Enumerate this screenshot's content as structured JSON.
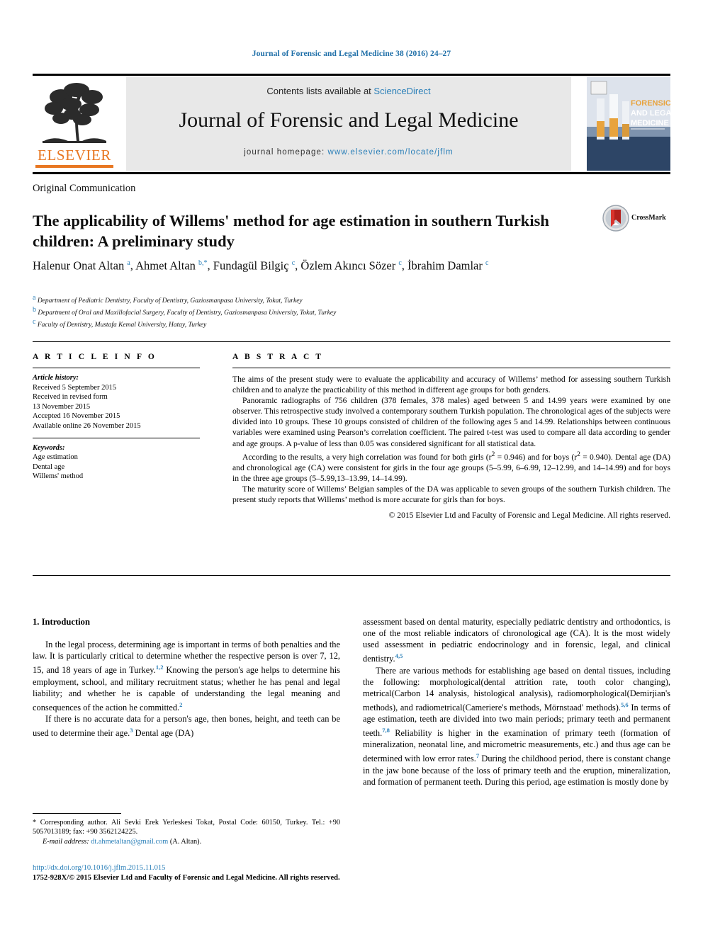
{
  "running_head": "Journal of Forensic and Legal Medicine 38 (2016) 24–27",
  "masthead": {
    "contents_prefix": "Contents lists available at ",
    "contents_link": "ScienceDirect",
    "journal_name": "Journal of Forensic and Legal Medicine",
    "homepage_prefix": "journal homepage: ",
    "homepage_url": "www.elsevier.com/locate/jflm",
    "publisher": "ELSEVIER",
    "cover_title_line1": "FORENSIC",
    "cover_title_line2": "AND LEGAL",
    "cover_title_line3": "MEDICINE",
    "link_color": "#2a7fb8",
    "brand_orange": "#E87722"
  },
  "article": {
    "kicker": "Original Communication",
    "title": "The applicability of Willems' method for age estimation in southern Turkish children: A preliminary study",
    "crossmark_label": "CrossMark",
    "authors_html": "Halenur Onat Altan <sup>a</sup>, Ahmet Altan <sup>b,&#42;</sup>, Fundagül Bilgiç <sup>c</sup>, Özlem Akıncı Sözer <sup>c</sup>, İbrahim Damlar <sup>c</sup>",
    "affiliations": [
      {
        "marker": "a",
        "text": "Department of Pediatric Dentistry, Faculty of Dentistry, Gaziosmanpasa University, Tokat, Turkey"
      },
      {
        "marker": "b",
        "text": "Department of Oral and Maxillofacial Surgery, Faculty of Dentistry, Gaziosmanpasa University, Tokat, Turkey"
      },
      {
        "marker": "c",
        "text": "Faculty of Dentistry, Mustafa Kemal University, Hatay, Turkey"
      }
    ]
  },
  "article_info": {
    "heading": "A R T I C L E  I N F O",
    "history_label": "Article history:",
    "history_lines": [
      "Received 5 September 2015",
      "Received in revised form",
      "13 November 2015",
      "Accepted 16 November 2015",
      "Available online 26 November 2015"
    ],
    "keywords_label": "Keywords:",
    "keywords": [
      "Age estimation",
      "Dental age",
      "Willems' method"
    ]
  },
  "abstract": {
    "heading": "A B S T R A C T",
    "paragraphs": [
      "The aims of the present study were to evaluate the applicability and accuracy of Willems’ method for assessing southern Turkish children and to analyze the practicability of this method in different age groups for both genders.",
      "Panoramic radiographs of 756 children (378 females, 378 males) aged between 5 and 14.99 years were examined by one observer. This retrospective study involved a contemporary southern Turkish population. The chronological ages of the subjects were divided into 10 groups. These 10 groups consisted of children of the following ages 5 and 14.99. Relationships between continuous variables were examined using Pearson’s correlation coefficient. The paired t-test was used to compare all data according to gender and age groups. A p-value of less than 0.05 was considered significant for all statistical data.",
      "According to the results, a very high correlation was found for both girls (r<sup>2</sup> = 0.946) and for boys (r<sup>2</sup> = 0.940). Dental age (DA) and chronological age (CA) were consistent for girls in the four age groups (5–5.99, 6–6.99, 12–12.99, and 14–14.99) and for boys in the three age groups (5–5.99,13–13.99, 14–14.99).",
      "The maturity score of Willems’ Belgian samples of the DA was applicable to seven groups of the southern Turkish children. The present study reports that Willems’ method is more accurate for girls than for boys."
    ],
    "copyright": "© 2015 Elsevier Ltd and Faculty of Forensic and Legal Medicine. All rights reserved."
  },
  "body": {
    "section_number_title": "1. Introduction",
    "left_paragraphs": [
      "In the legal process, determining age is important in terms of both penalties and the law. It is particularly critical to determine whether the respective person is over 7, 12, 15, and 18 years of age in Turkey.<sup class=\"ref\">1,2</sup> Knowing the person's age helps to determine his employment, school, and military recruitment status; whether he has penal and legal liability; and whether he is capable of understanding the legal meaning and consequences of the action he committed.<sup class=\"ref\">2</sup>",
      "If there is no accurate data for a person's age, then bones, height, and teeth can be used to determine their age.<sup class=\"ref\">3</sup> Dental age (DA)"
    ],
    "right_paragraphs": [
      "assessment based on dental maturity, especially pediatric dentistry and orthodontics, is one of the most reliable indicators of chronological age (CA). It is the most widely used assessment in pediatric endocrinology and in forensic, legal, and clinical dentistry.<sup class=\"ref\">4,5</sup>",
      "There are various methods for establishing age based on dental tissues, including the following: morphological(dental attrition rate, tooth color changing), metrical(Carbon 14 analysis, histological analysis), radiomorphological(Demirjian's methods), and radiometrical(Cameriere's methods, Mörnstaad' methods).<sup class=\"ref\">5,6</sup> In terms of age estimation, teeth are divided into two main periods; primary teeth and permanent teeth.<sup class=\"ref\">7,8</sup> Reliability is higher in the examination of primary teeth (formation of mineralization, neonatal line, and micrometric measurements, etc.) and thus age can be determined with low error rates.<sup class=\"ref\">7</sup> During the childhood period, there is constant change in the jaw bone because of the loss of primary teeth and the eruption, mineralization, and formation of permanent teeth. During this period, age estimation is mostly done by"
    ]
  },
  "footnote": {
    "corresponding_html": "<span class=\"star\">*</span> Corresponding author. Ali Sevki Erek Yerleskesi Tokat, Postal Code: 60150, Turkey. Tel.: +90 5057013189; fax: +90 3562124225.",
    "email_label": "E-mail address:",
    "email": "dt.ahmetaltan@gmail.com",
    "email_owner": "(A. Altan)."
  },
  "doi": {
    "url": "http://dx.doi.org/10.1016/j.jflm.2015.11.015",
    "copyright_line": "1752-928X/© 2015 Elsevier Ltd and Faculty of Forensic and Legal Medicine. All rights reserved."
  }
}
